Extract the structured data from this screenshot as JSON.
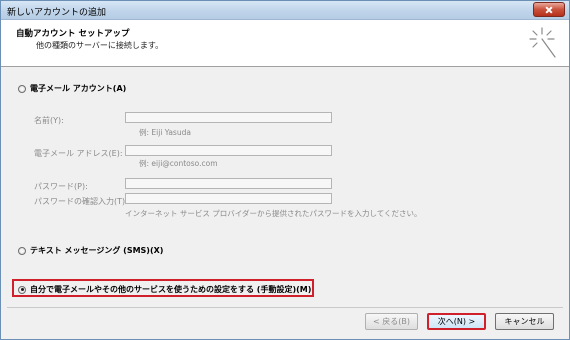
{
  "window": {
    "title": "新しいアカウントの追加"
  },
  "header": {
    "title": "自動アカウント セットアップ",
    "subtitle": "他の種類のサーバーに接続します。"
  },
  "options": {
    "email_account": {
      "label": "電子メール アカウント(A)",
      "selected": false
    },
    "text_messaging": {
      "label": "テキスト メッセージング (SMS)(X)",
      "selected": false
    },
    "manual_setup": {
      "label": "自分で電子メールやその他のサービスを使うための設定をする (手動設定)(M)",
      "selected": true
    }
  },
  "fields": {
    "name": {
      "label": "名前(Y):",
      "value": "",
      "hint": "例: Eiji Yasuda"
    },
    "email": {
      "label": "電子メール アドレス(E):",
      "value": "",
      "hint": "例: eiji@contoso.com"
    },
    "password": {
      "label": "パスワード(P):",
      "value": ""
    },
    "password_confirm": {
      "label": "パスワードの確認入力(T):",
      "value": "",
      "hint": "インターネット サービス プロバイダーから提供されたパスワードを入力してください。"
    }
  },
  "buttons": {
    "back": "< 戻る(B)",
    "next": "次へ(N) >",
    "cancel": "キャンセル"
  },
  "colors": {
    "highlight": "#d0202c",
    "titlebar": "#c0d5ea"
  },
  "icons": {
    "close": "close-icon",
    "wizard": "wizard-sparkle-icon"
  }
}
